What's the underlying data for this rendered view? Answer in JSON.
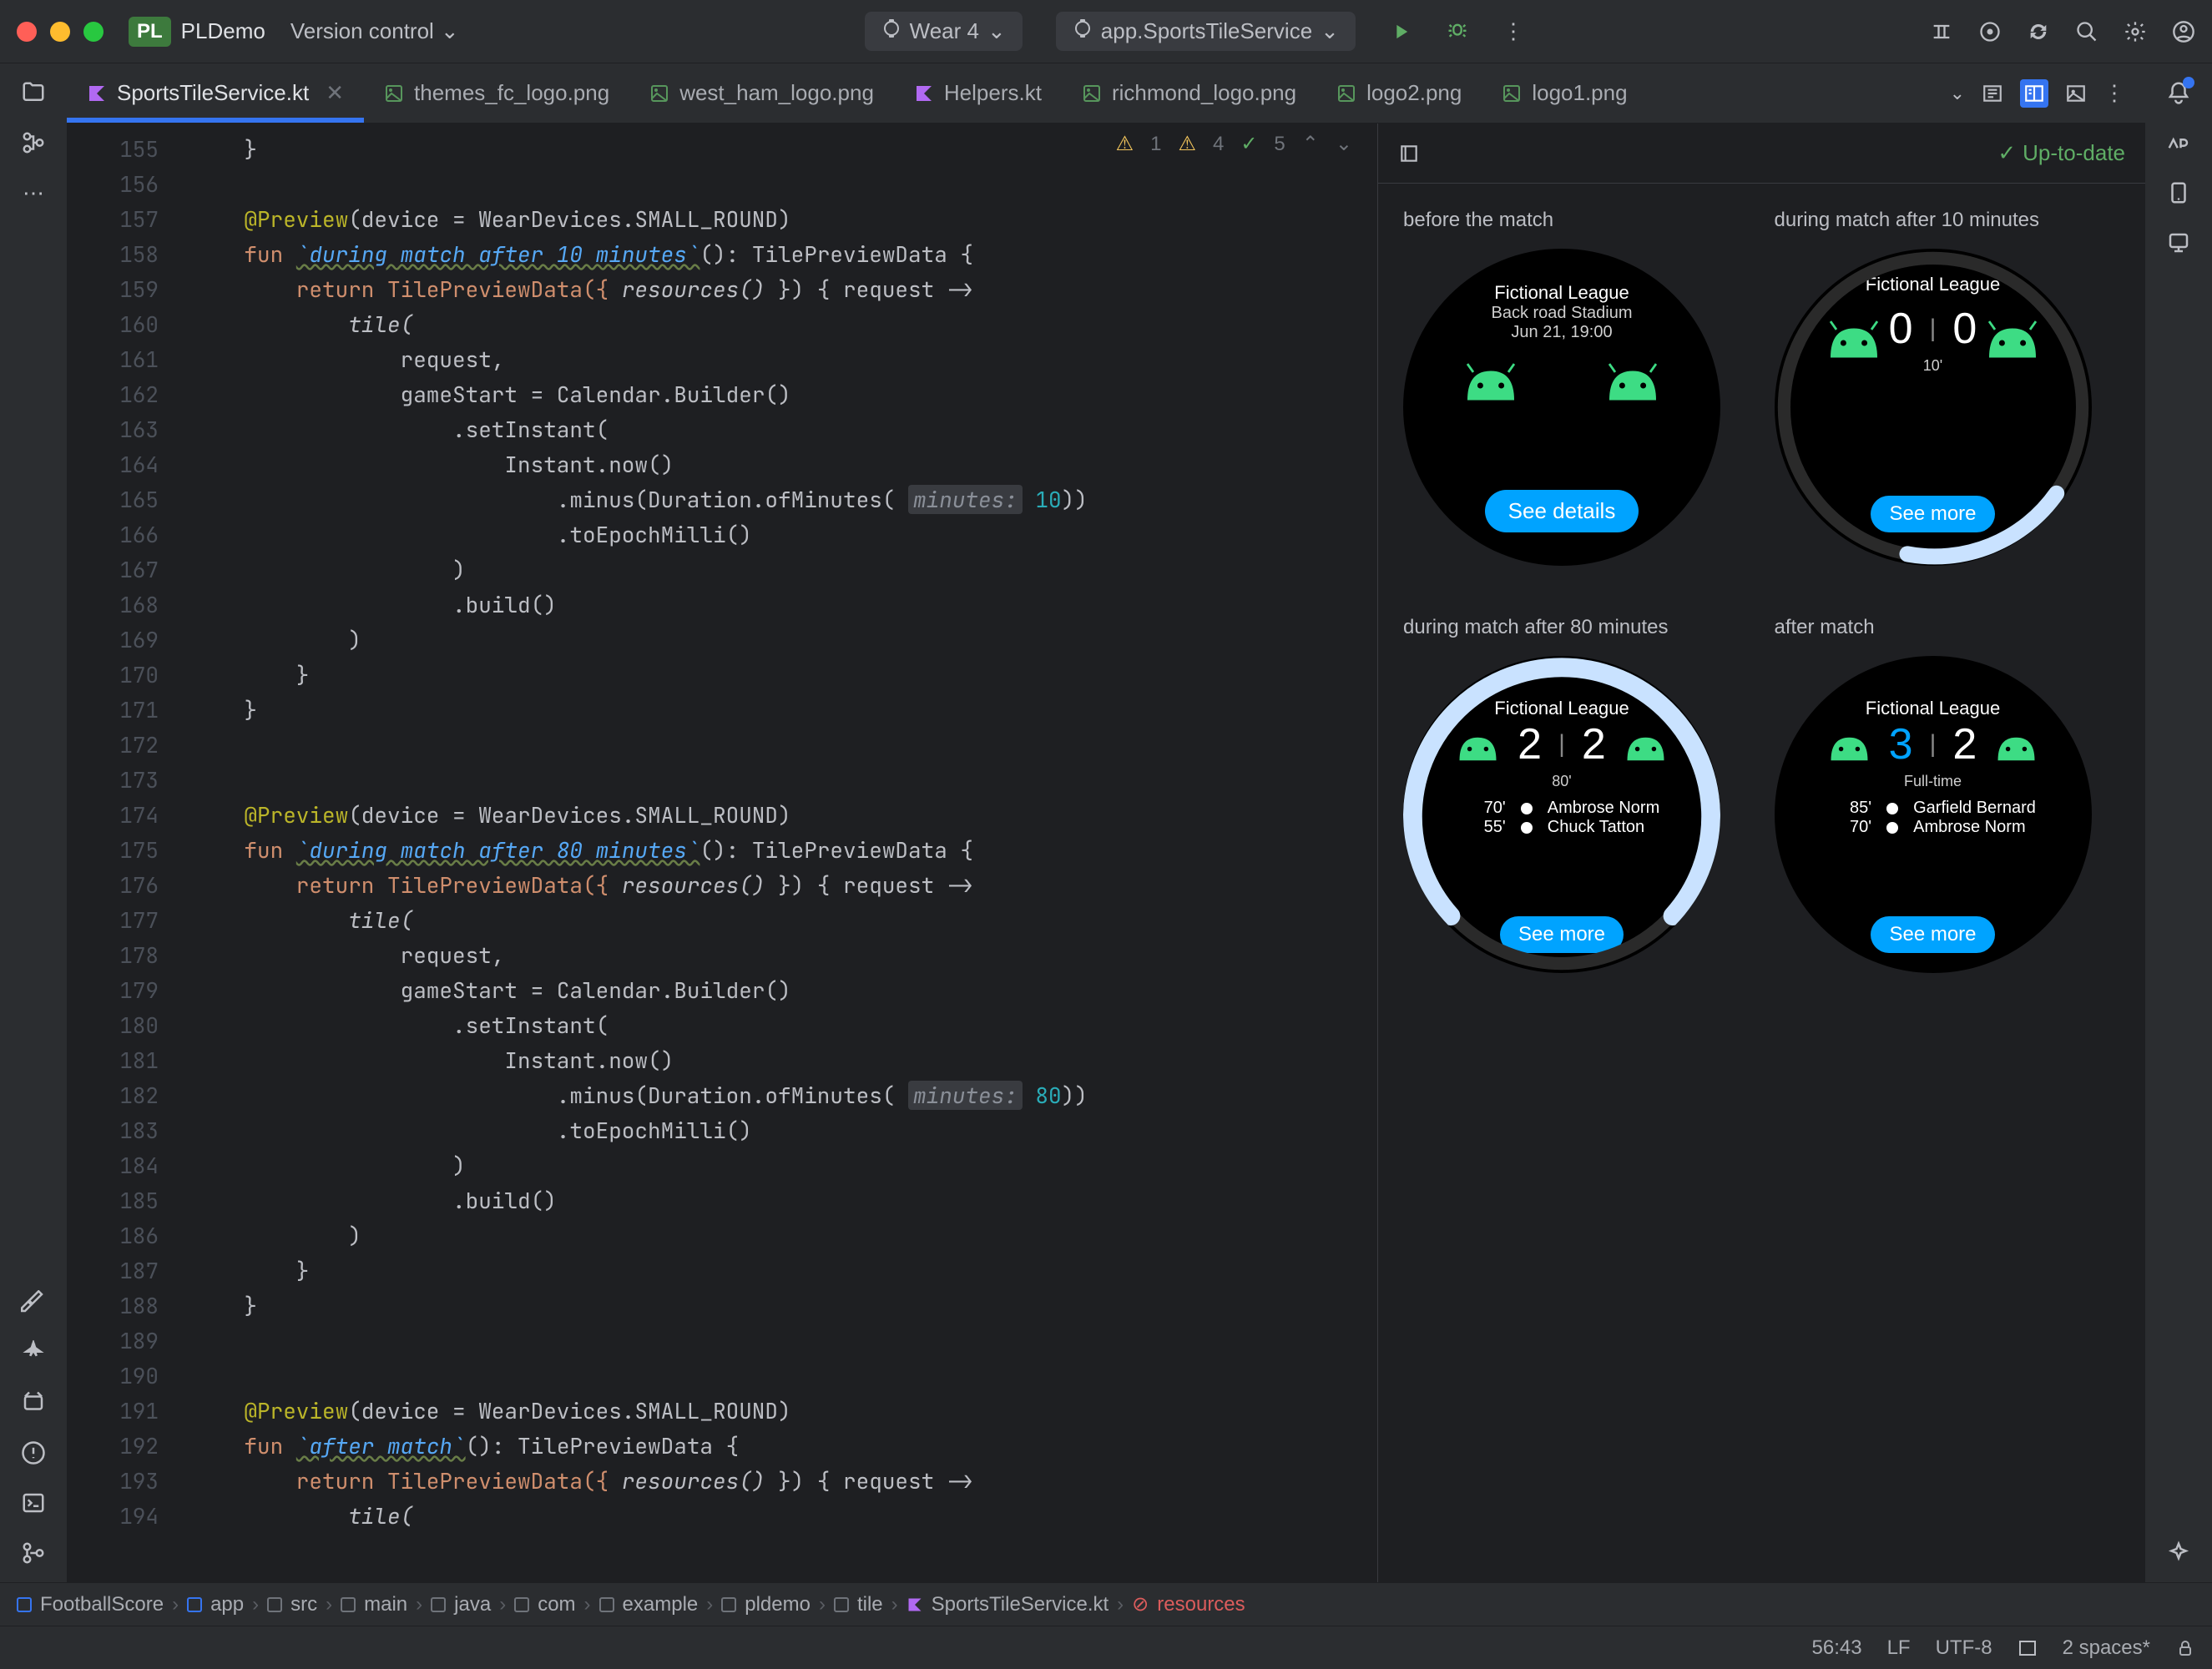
{
  "titlebar": {
    "project_tag": "PL",
    "project_name": "PLDemo",
    "vcs_label": "Version control",
    "device_label": "Wear 4",
    "run_config_label": "app.SportsTileService"
  },
  "tabs": [
    {
      "name": "SportsTileService.kt",
      "active": true,
      "icon": "kotlin"
    },
    {
      "name": "themes_fc_logo.png",
      "active": false,
      "icon": "image"
    },
    {
      "name": "west_ham_logo.png",
      "active": false,
      "icon": "image"
    },
    {
      "name": "Helpers.kt",
      "active": false,
      "icon": "kotlin"
    },
    {
      "name": "richmond_logo.png",
      "active": false,
      "icon": "image"
    },
    {
      "name": "logo2.png",
      "active": false,
      "icon": "image"
    },
    {
      "name": "logo1.png",
      "active": false,
      "icon": "image"
    }
  ],
  "inspection": {
    "errors": "1",
    "warnings": "4",
    "oks": "5"
  },
  "gutter_lines": [
    "155",
    "156",
    "157",
    "158",
    "159",
    "160",
    "161",
    "162",
    "163",
    "164",
    "165",
    "166",
    "167",
    "168",
    "169",
    "170",
    "171",
    "172",
    "173",
    "174",
    "175",
    "176",
    "177",
    "178",
    "179",
    "180",
    "181",
    "182",
    "183",
    "184",
    "185",
    "186",
    "187",
    "188",
    "189",
    "190",
    "191",
    "192",
    "193",
    "194"
  ],
  "code": {
    "l1": "    }",
    "l2": "",
    "ann_a": "    @Preview",
    "ann_a_args": "(device = WearDevices.SMALL_ROUND)",
    "fun_a": "    fun ",
    "fn_a_name": "`during match after 10 minutes`",
    "fn_a_sig": "(): TilePreviewData {",
    "ret": "        return TilePreviewData({ ",
    "res_call": "resources()",
    "ret_tail": " }) { request ->",
    "tile": "            tile(",
    "req": "                request,",
    "gstart": "                gameStart",
    "eq": " = Calendar.Builder()",
    "setI": "                    .setInstant(",
    "now": "                        Instant.now()",
    "minus": "                            .minus(Duration.ofMinutes( ",
    "pminutes": "minutes:",
    "ten": " 10",
    "eighty": " 80",
    "minus_tail": "))",
    "epoch": "                            .toEpochMilli()",
    "cp1": "                    )",
    "build": "                    .build()",
    "cp2": "            )",
    "cp3": "        }",
    "cp4": "    }",
    "fn_b_name": "`during match after 80 minutes`",
    "fn_c_name": "`after match`",
    "fn_c_sig": "(): TilePreviewData {"
  },
  "preview": {
    "uptodate_label": "Up-to-date",
    "cards": [
      {
        "label": "before the match",
        "league": "Fictional League",
        "stadium": "Back road Stadium",
        "date": "Jun 21, 19:00",
        "button": "See details"
      },
      {
        "label": "during match after 10 minutes",
        "league": "Fictional League",
        "score_home": "0",
        "score_away": "0",
        "time": "10'",
        "button": "See more"
      },
      {
        "label": "during match after 80 minutes",
        "league": "Fictional League",
        "score_home": "2",
        "score_away": "2",
        "time": "80'",
        "button": "See more",
        "scorers": [
          {
            "min": "70'",
            "name": "Ambrose Norm"
          },
          {
            "min": "55'",
            "name": "Chuck Tatton"
          }
        ]
      },
      {
        "label": "after match",
        "league": "Fictional League",
        "score_home": "3",
        "score_away": "2",
        "ft": "Full-time",
        "button": "See more",
        "scorers": [
          {
            "min": "85'",
            "name": "Garfield Bernard"
          },
          {
            "min": "70'",
            "name": "Ambrose Norm"
          }
        ]
      }
    ]
  },
  "breadcrumbs": [
    "FootballScore",
    "app",
    "src",
    "main",
    "java",
    "com",
    "example",
    "pldemo",
    "tile",
    "SportsTileService.kt",
    "resources"
  ],
  "statusbar": {
    "pos": "56:43",
    "lf": "LF",
    "enc": "UTF-8",
    "indent": "2 spaces*"
  }
}
